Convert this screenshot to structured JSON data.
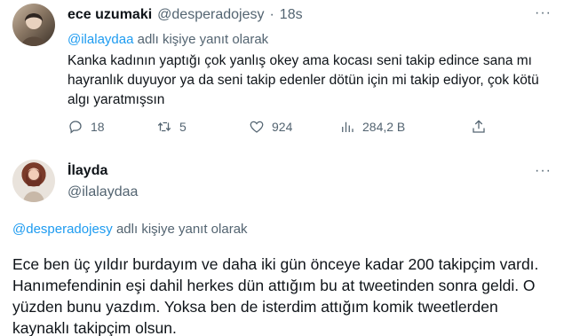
{
  "tweet1": {
    "display_name": "ece uzumaki",
    "handle": "@desperadojesy",
    "separator": "·",
    "timestamp": "18s",
    "more_label": "···",
    "replying_to_handle": "@ilalaydaa",
    "replying_to_suffix": " adlı kişiye yanıt olarak",
    "body": "Kanka kadının yaptığı çok yanlış okey ama kocası seni takip edince sana mı hayranlık duyuyor ya da seni takip edenler dötün için mi takip ediyor, çok kötü algı yaratmışsın",
    "actions": {
      "replies": "18",
      "retweets": "5",
      "likes": "924",
      "views": "284,2 B"
    }
  },
  "tweet2": {
    "display_name": "İlayda",
    "handle": "@ilalaydaa",
    "more_label": "···",
    "replying_to_handle": "@desperadojesy",
    "replying_to_suffix": " adlı kişiye yanıt olarak",
    "body": "Ece ben üç yıldır burdayım ve daha iki gün önceye kadar 200 takipçim vardı. Hanımefendinin eşi dahil herkes dün attığım bu at tweetinden sonra geldi. O yüzden bunu yazdım. Yoksa ben de isterdim attığım komik tweetlerden kaynaklı takipçim olsun."
  },
  "colors": {
    "text": "#0f1419",
    "secondary": "#536471",
    "accent": "#1d9bf0"
  },
  "icons": [
    "reply-icon",
    "retweet-icon",
    "like-icon",
    "views-icon",
    "share-icon",
    "more-icon"
  ]
}
